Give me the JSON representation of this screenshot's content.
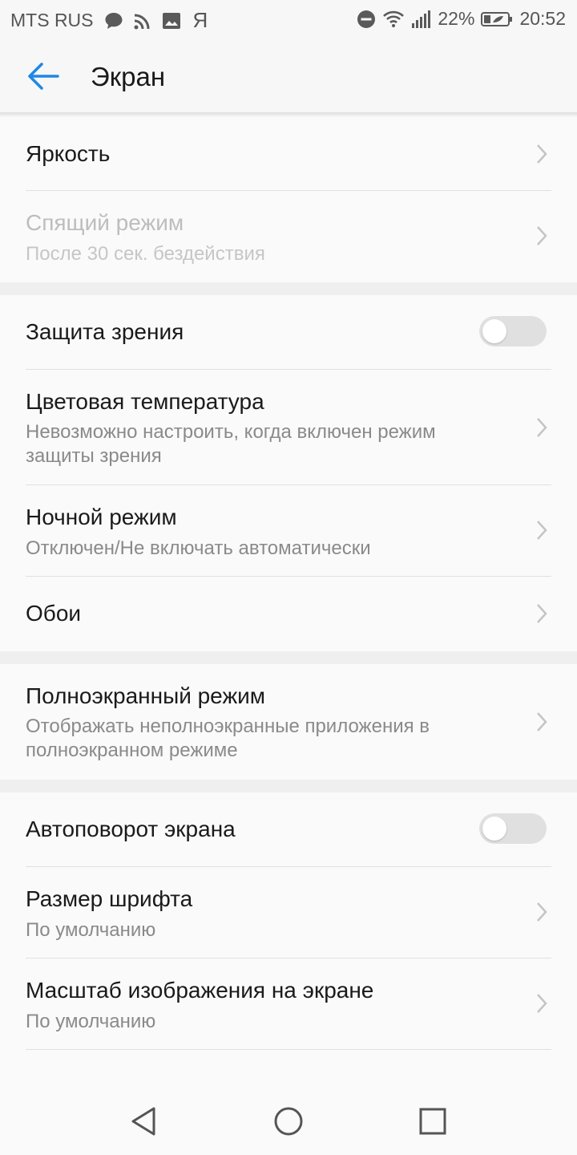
{
  "status_bar": {
    "carrier": "MTS RUS",
    "yandex": "Я",
    "battery": "22%",
    "time": "20:52",
    "icons": [
      "message-icon",
      "cast-icon",
      "image-icon",
      "do-not-disturb-icon",
      "wifi-icon",
      "signal-icon",
      "battery-icon"
    ]
  },
  "header": {
    "title": "Экран",
    "back_icon": "arrow-left-icon",
    "accent_color": "#1e88e5"
  },
  "groups": [
    {
      "items": [
        {
          "title": "Яркость",
          "subtitle": "",
          "control": "chevron",
          "enabled": true
        },
        {
          "title": "Спящий режим",
          "subtitle": "После 30 сек. бездействия",
          "control": "chevron",
          "enabled": false
        }
      ]
    },
    {
      "items": [
        {
          "title": "Защита зрения",
          "subtitle": "",
          "control": "toggle",
          "on": false
        },
        {
          "title": "Цветовая температура",
          "subtitle": "Невозможно настроить, когда включен режим защиты зрения",
          "control": "chevron"
        },
        {
          "title": "Ночной режим",
          "subtitle": "Отключен/Не включать автоматически",
          "control": "chevron"
        },
        {
          "title": "Обои",
          "subtitle": "",
          "control": "chevron"
        }
      ]
    },
    {
      "items": [
        {
          "title": "Полноэкранный режим",
          "subtitle": "Отображать неполноэкранные приложения в полноэкранном режиме",
          "control": "chevron"
        }
      ]
    },
    {
      "items": [
        {
          "title": "Автоповорот экрана",
          "subtitle": "",
          "control": "toggle",
          "on": false
        },
        {
          "title": "Размер шрифта",
          "subtitle": "По умолчанию",
          "control": "chevron"
        },
        {
          "title": "Масштаб изображения на экране",
          "subtitle": "По умолчанию",
          "control": "chevron"
        }
      ]
    }
  ],
  "nav_bar": {
    "buttons": [
      "back-triangle-icon",
      "home-circle-icon",
      "recents-square-icon"
    ]
  }
}
